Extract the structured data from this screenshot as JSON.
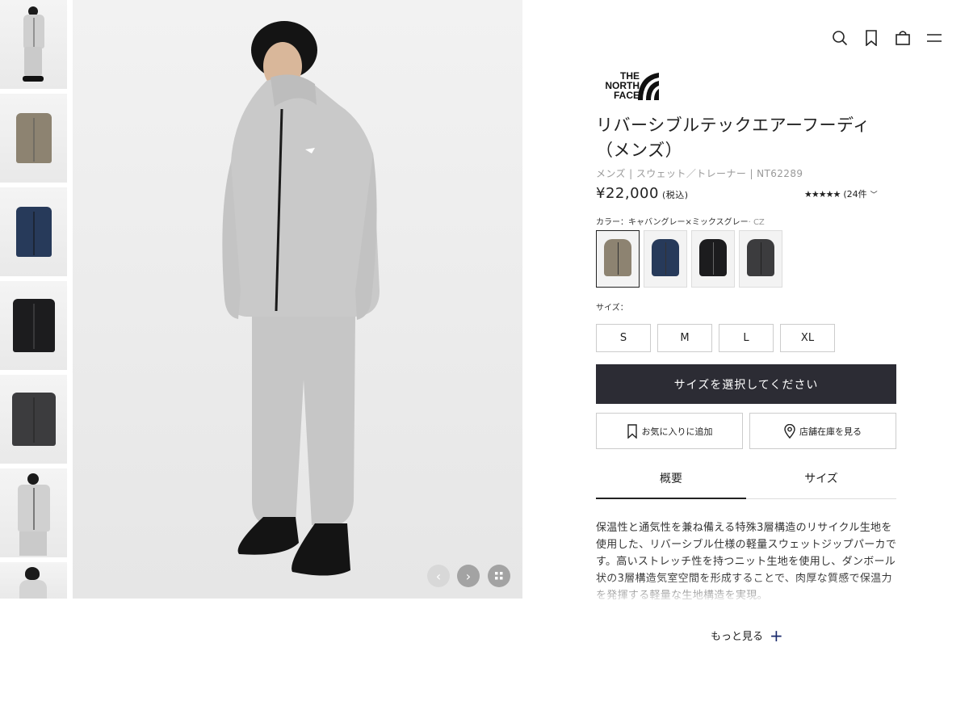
{
  "header": {
    "icons": [
      "search-icon",
      "bookmark-icon",
      "bag-icon",
      "menu-icon"
    ]
  },
  "brand": {
    "line1": "THE",
    "line2": "NORTH",
    "line3": "FACE"
  },
  "product": {
    "title": "リバーシブルテックエアーフーディ（メンズ）",
    "breadcrumb": "メンズ | スウェット／トレーナー | NT62289",
    "price": "¥22,000",
    "tax": "(税込)",
    "stars": "★★★★★",
    "rating_value": 4.5,
    "review_count": "(24件",
    "review_caret": "﹀"
  },
  "color": {
    "label": "カラー：キャバングレー×ミックスグレー",
    "code": "· CZ",
    "swatches": [
      {
        "name": "khaki",
        "color": "#8d8371",
        "selected": true
      },
      {
        "name": "navy",
        "color": "#273a5a",
        "selected": false
      },
      {
        "name": "black",
        "color": "#1c1c1e",
        "selected": false
      },
      {
        "name": "charcoal",
        "color": "#3c3c3e",
        "selected": false
      }
    ]
  },
  "size": {
    "label": "サイズ：",
    "options": [
      "S",
      "M",
      "L",
      "XL"
    ]
  },
  "actions": {
    "cta": "サイズを選択してください",
    "favorite": "お気に入りに追加",
    "store_stock": "店舗在庫を見る"
  },
  "tabs": [
    {
      "label": "概要",
      "active": true
    },
    {
      "label": "サイズ",
      "active": false
    }
  ],
  "description": "保温性と通気性を兼ね備える特殊3層構造のリサイクル生地を使用した、リバーシブル仕様の軽量スウェットジップパーカです。高いストレッチ性を持つニット生地を使用し、ダンボール状の3層構造気室空間を形成することで、肉厚な質感で保温力を発揮する軽量な生地構造を実現。",
  "more_label": "もっと見る",
  "colors": {
    "accent": "#1a2a6c",
    "cta_bg": "#2c2c34"
  }
}
